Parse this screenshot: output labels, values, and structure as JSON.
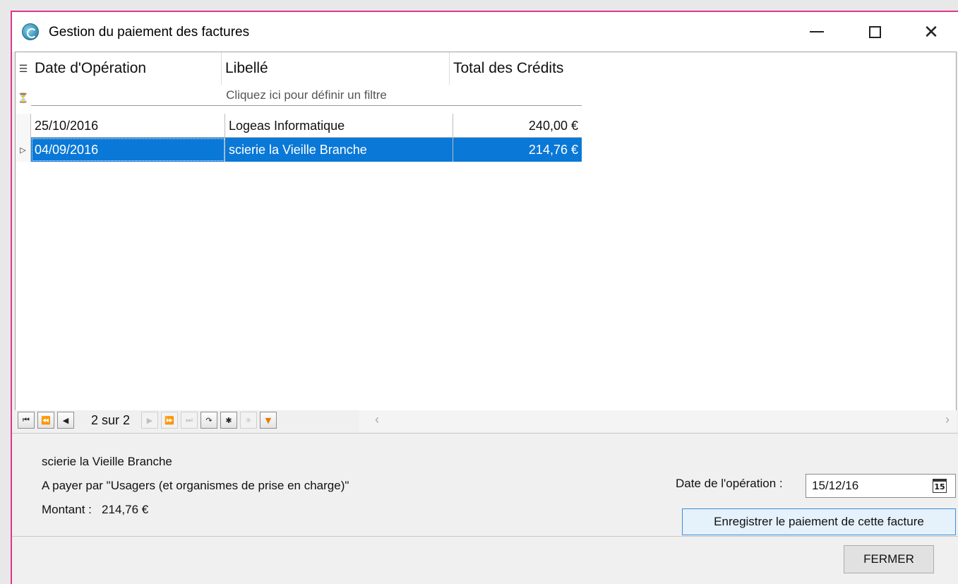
{
  "window": {
    "title": "Gestion du paiement des factures",
    "controls": {
      "minimize": "minimize-icon",
      "maximize": "maximize-icon",
      "close": "close-icon"
    }
  },
  "grid": {
    "columns": [
      "Date d'Opération",
      "Libellé",
      "Total des Crédits"
    ],
    "filter_hint": "Cliquez ici pour définir un filtre",
    "rows": [
      {
        "date": "25/10/2016",
        "label": "Logeas Informatique",
        "total": "240,00 €",
        "selected": false
      },
      {
        "date": "04/09/2016",
        "label": "scierie la Vieille Branche",
        "total": "214,76 €",
        "selected": true
      }
    ],
    "selection_color": "#0a78d7"
  },
  "navigator": {
    "position": "2 sur 2",
    "buttons": [
      "first-icon",
      "prev-page-icon",
      "prev-icon",
      "next-icon",
      "next-page-icon",
      "last-icon",
      "refresh-icon",
      "add-icon",
      "delete-icon",
      "filter-icon"
    ]
  },
  "details": {
    "supplier": "scierie la Vieille Branche",
    "payer_line": "A payer par \"Usagers (et organismes de prise en charge)\"",
    "amount_line": "Montant :   214,76 €",
    "date_label": "Date de l'opération :",
    "date_value": "15/12/16",
    "calendar_label": "15",
    "save_label": "Enregistrer le paiement de cette facture"
  },
  "footer": {
    "close_label": "FERMER"
  }
}
